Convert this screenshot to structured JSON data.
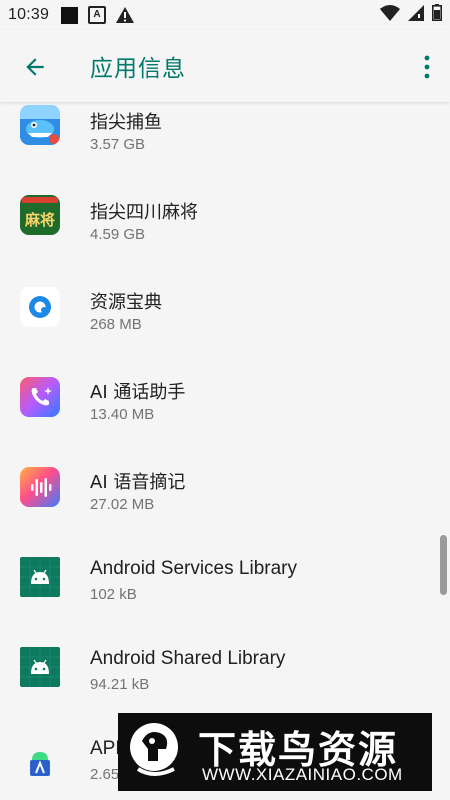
{
  "status_bar": {
    "time": "10:39",
    "a_glyph": "A"
  },
  "app_bar": {
    "title": "应用信息"
  },
  "apps": [
    {
      "name": "指尖捕鱼",
      "size": "3.57 GB",
      "icon": "fishing-game-icon"
    },
    {
      "name": "指尖四川麻将",
      "size": "4.59 GB",
      "icon": "mahjong-game-icon"
    },
    {
      "name": "资源宝典",
      "size": "268 MB",
      "icon": "resource-book-icon"
    },
    {
      "name": "AI 通话助手",
      "size": "13.40 MB",
      "icon": "phone-assistant-icon"
    },
    {
      "name": "AI 语音摘记",
      "size": "27.02 MB",
      "icon": "voice-memo-icon"
    },
    {
      "name": "Android Services Library",
      "size": "102 kB",
      "icon": "android-icon"
    },
    {
      "name": "Android Shared Library",
      "size": "94.21 kB",
      "icon": "android-icon"
    },
    {
      "name": "APK",
      "size": "2.65",
      "icon": "apk-installer-icon"
    }
  ],
  "mahjong_icon_text": "麻将",
  "watermark": {
    "title": "下载鸟资源",
    "url": "WWW.XIAZAINIAO.COM"
  },
  "colors": {
    "accent": "#00796b",
    "android_icon_bg": "#0d7a5f"
  }
}
